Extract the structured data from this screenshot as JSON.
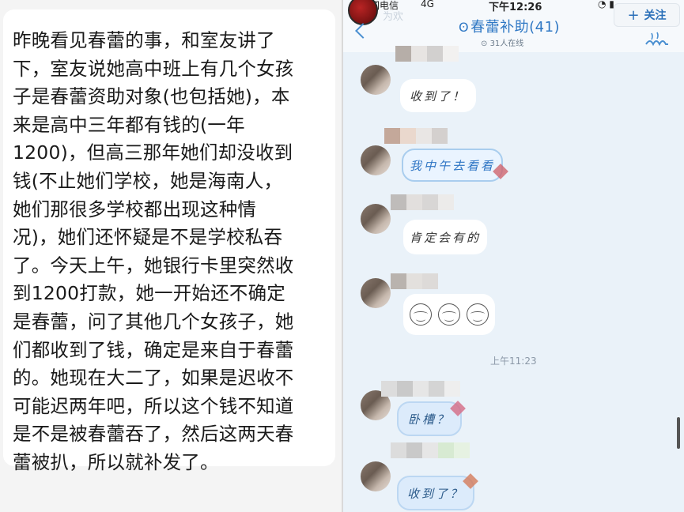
{
  "note": {
    "text": "昨晚看见春蕾的事，和室友讲了\n下，室友说她高中班上有几个女孩\n子是春蕾资助对象(也包括她)，本\n来是高中三年都有钱的(一年\n1200)，但高三那年她们却没收到\n钱(不止她们学校，她是海南人，\n她们那很多学校都出现这种情\n况)，她们还怀疑是不是学校私吞\n了。今天上午，她银行卡里突然收\n到1200打款，她一开始还不确定\n是春蕾，问了其他几个女孩子，她\n们都收到了钱，确定是来自于春蕾\n的。她现在大二了，如果是迟收不\n可能迟两年吧，所以这个钱不知道\n是不是被春蕾吞了，然后这两天春\n蕾被扒，所以就补发了。"
  },
  "status_bar": {
    "carrier": "中国电信",
    "network": "4G",
    "time": "下午12:26"
  },
  "chat_header": {
    "faded_title": "为欢",
    "group_name": "春蕾补助(41)",
    "online_count": "31人在线",
    "follow_label": "关注"
  },
  "messages": [
    {
      "text": "收到了！"
    },
    {
      "text": "我中午去看看"
    },
    {
      "text": "肯定会有的"
    },
    {
      "text": ""
    },
    {
      "text": "卧槽？"
    },
    {
      "text": "收到了？"
    }
  ],
  "time_separator": "上午11:23",
  "colors": {
    "accent": "#2f78c4",
    "chat_bg": "#eaf2f9",
    "bubble_blue": "#dcebfb"
  },
  "icons": {
    "back": "chevron-left-icon",
    "ear": "ear-icon",
    "menu": "group-menu-icon",
    "plus": "plus-icon"
  }
}
